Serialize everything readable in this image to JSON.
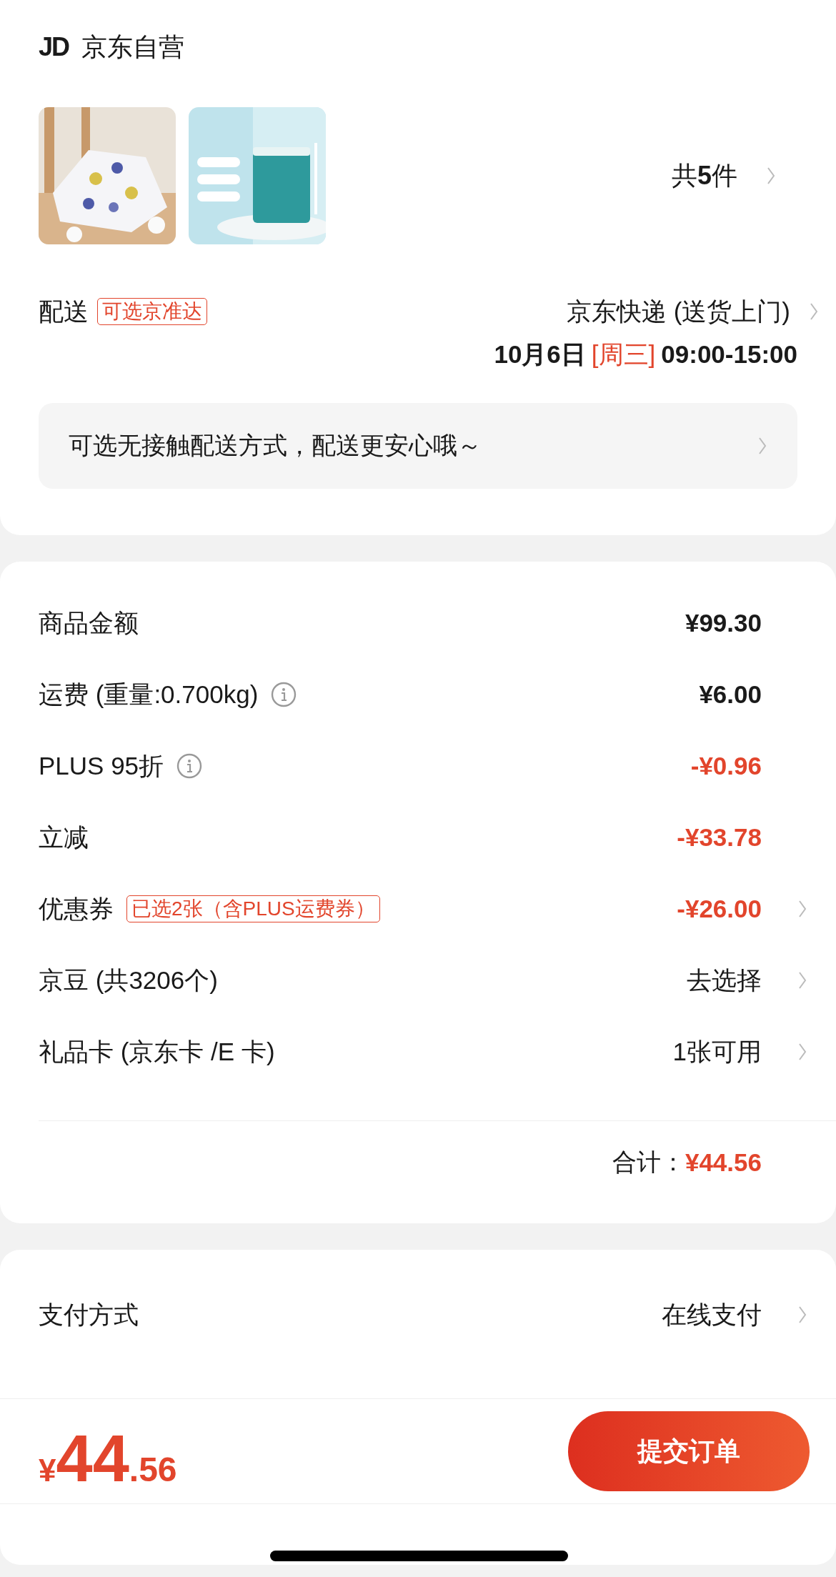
{
  "store": {
    "logo": "JD",
    "name": "京东自营"
  },
  "products": {
    "count": "共**5**件"
  },
  "delivery": {
    "label": "配送",
    "tag": "可选京准达",
    "method": "京东快递 (送货上门)",
    "date": "10月6日",
    "weekday": "[周三]",
    "time": "09:00-15:00"
  },
  "notice": "可选无接触配送方式，配送更安心哦～",
  "charges": [
    {
      "label": "商品金额",
      "info": false,
      "value": "¥99.30",
      "highlight": false,
      "chevron": false,
      "plain": false
    },
    {
      "label": "运费 (重量:0.700kg)",
      "info": true,
      "value": "¥6.00",
      "highlight": false,
      "chevron": false,
      "plain": false
    },
    {
      "label": "PLUS 95折",
      "info": true,
      "value": "-¥0.96",
      "highlight": true,
      "chevron": false,
      "plain": false
    },
    {
      "label": "立减",
      "info": false,
      "value": "-¥33.78",
      "highlight": true,
      "chevron": false,
      "plain": false
    },
    {
      "label": "优惠券",
      "tag": "已选2张（含PLUS运费券）",
      "info": false,
      "value": "-¥26.00",
      "highlight": true,
      "chevron": true,
      "plain": false
    },
    {
      "label": "京豆 (共3206个)",
      "info": false,
      "value": "去选择",
      "highlight": false,
      "chevron": true,
      "plain": true
    },
    {
      "label": "礼品卡 (京东卡 /E 卡)",
      "info": false,
      "value": "1张可用",
      "highlight": false,
      "chevron": true,
      "plain": true
    }
  ],
  "total": {
    "label": "合计：",
    "amount": "¥44.56"
  },
  "payment": [
    {
      "kind": "link",
      "label": "支付方式",
      "value": "在线支付"
    }
  ],
  "footer": {
    "currency": "¥",
    "integer": "44",
    "decimal": ".56",
    "submit": "提交订单"
  }
}
